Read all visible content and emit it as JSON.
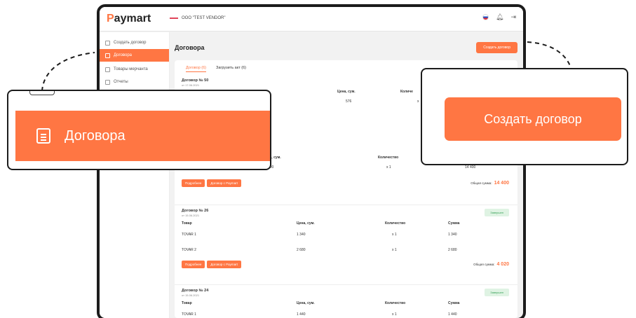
{
  "app": {
    "logo_initial": "P",
    "logo_rest": "aymart",
    "vendor": "OOO \"TEST VENDOR\""
  },
  "sidebar": {
    "items": [
      {
        "label": "Создать договор"
      },
      {
        "label": "Договора",
        "active": true
      },
      {
        "label": "Товары мерчанта"
      },
      {
        "label": "Отчеты"
      }
    ]
  },
  "main": {
    "page_title": "Договора",
    "create_button": "Создать договор",
    "tabs": [
      {
        "label": "Договор (6)",
        "active": true
      },
      {
        "label": "Загрузить акт (6)"
      }
    ]
  },
  "table_headers": {
    "product": "Товар",
    "price": "Цена, сум.",
    "quantity": "Количество",
    "sum": "Сумма"
  },
  "contracts": [
    {
      "title": "Договор № 50",
      "date": "от 17.06.2021",
      "row": {
        "price": "576",
        "quantity_partial": "x"
      },
      "header_qty_partial": "Количе"
    },
    {
      "row": {
        "price": "14 400",
        "quantity": "x 1",
        "sum": "14 400"
      },
      "details": "Подробнее",
      "contract_paymart": "Договор с Paymart",
      "total_label": "Общая сумма:",
      "total": "14 400"
    },
    {
      "title": "Договор № 26",
      "date": "от 15.06.2021",
      "status": "Завершен",
      "items": [
        {
          "name": "TOVAR 1",
          "price": "1 340",
          "quantity": "x 1",
          "sum": "1 340"
        },
        {
          "name": "TOVAR 2",
          "price": "2 680",
          "quantity": "x 1",
          "sum": "2 680"
        }
      ],
      "details": "Подробнее",
      "contract_paymart": "Договор с Paymart",
      "total_label": "Общая сумма:",
      "total": "4 020"
    },
    {
      "title": "Договор № 24",
      "date": "от 15.06.2021",
      "status": "Завершен",
      "items": [
        {
          "name": "TOVAR 1",
          "price": "1 440",
          "quantity": "x 1",
          "sum": "1 440"
        }
      ]
    }
  ],
  "callouts": {
    "left_label": "Договора",
    "right_label": "Создать договор"
  },
  "colors": {
    "accent": "#ff7643",
    "frame": "#1c1c1c",
    "status_bg": "#dff3e3",
    "status_text": "#3aa35a"
  }
}
